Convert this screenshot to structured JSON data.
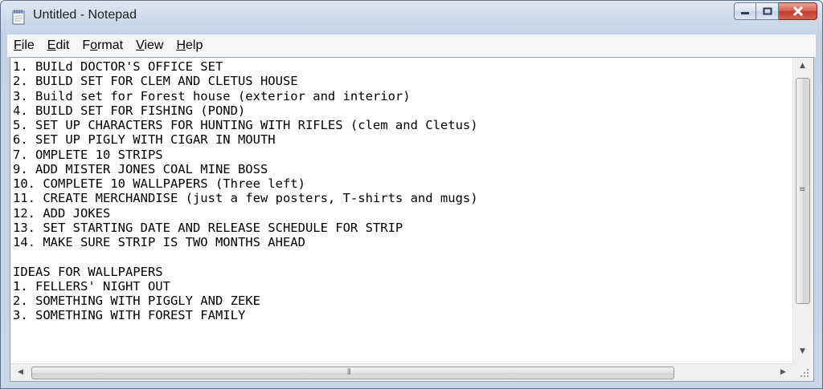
{
  "window": {
    "title": "Untitled - Notepad",
    "buttons": {
      "minimize": "minimize",
      "maximize": "maximize",
      "close": "close"
    }
  },
  "menu": [
    {
      "accel": "F",
      "rest": "ile"
    },
    {
      "accel": "E",
      "rest": "dit"
    },
    {
      "pre": "F",
      "accel": "o",
      "rest": "rmat"
    },
    {
      "accel": "V",
      "rest": "iew"
    },
    {
      "accel": "H",
      "rest": "elp"
    }
  ],
  "editor": {
    "text": "1. BUILd DOCTOR'S OFFICE SET\n2. BUILD SET FOR CLEM AND CLETUS HOUSE\n3. Build set for Forest house (exterior and interior)\n4. BUILD SET FOR FISHING (POND)\n5. SET UP CHARACTERS FOR HUNTING WITH RIFLES (clem and Cletus)\n6. SET UP PIGLY WITH CIGAR IN MOUTH\n7. OMPLETE 10 STRIPS\n9. ADD MISTER JONES COAL MINE BOSS\n10. COMPLETE 10 WALLPAPERS (Three left)\n11. CREATE MERCHANDISE (just a few posters, T-shirts and mugs)\n12. ADD JOKES\n13. SET STARTING DATE AND RELEASE SCHEDULE FOR STRIP\n14. MAKE SURE STRIP IS TWO MONTHS AHEAD\n\nIDEAS FOR WALLPAPERS\n1. FELLERS' NIGHT OUT\n2. SOMETHING WITH PIGGLY AND ZEKE\n3. SOMETHING WITH FOREST FAMILY"
  },
  "icons": {
    "app": "notepad-icon",
    "up": "▲",
    "down": "▼",
    "left": "◀",
    "right": "▶",
    "grip_v": "≡",
    "grip_h": "⦀"
  },
  "colors": {
    "close_button": "#c23a2b",
    "menu_bg": "#f5f6f7",
    "frame": "#c9d6e8"
  }
}
